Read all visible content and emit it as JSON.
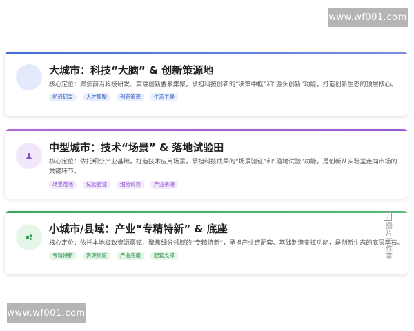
{
  "watermarks": {
    "top": "www.wf001.com",
    "bottom": "www.wf001.com"
  },
  "colors": {
    "large_city": "#4a72d8",
    "mid_city": "#a35bd6",
    "small_city": "#3ea463"
  },
  "cards": [
    {
      "icon": "brain-icon",
      "title": "大城市：科技“大脑” & 创新策源地",
      "desc": "核心定位：聚焦前沿科技研发、高端创新要素集聚，承担科技创新的“决策中枢”和“源头创新”功能，打造创新生态的顶层核心。",
      "tags": [
        "前沿研发",
        "人才集聚",
        "创新策源",
        "生态主导"
      ]
    },
    {
      "icon": "flask-icon",
      "title": "中型城市：技术“场景” & 落地试验田",
      "desc": "核心定位：依托细分产业基础，打造技术应用场景，承担科技成果的“场景验证”和“落地试验”功能，是创新从实验室走向市场的关键环节。",
      "tags": [
        "场景落地",
        "试验验证",
        "细分优势",
        "产业承接"
      ]
    },
    {
      "icon": "gears-icon",
      "title": "小城市/县域：产业“专精特新” & 底座",
      "desc": "核心定位：依托本地极致资源禀赋，聚焦细分领域的“专精特新”，承担产业链配套、基础制造支撑功能，是创新生态的底层基石。",
      "tags": [
        "专精特新",
        "资源禀赋",
        "产业底座",
        "配套支撑"
      ]
    }
  ],
  "stamp": {
    "text": "图片工作室"
  }
}
